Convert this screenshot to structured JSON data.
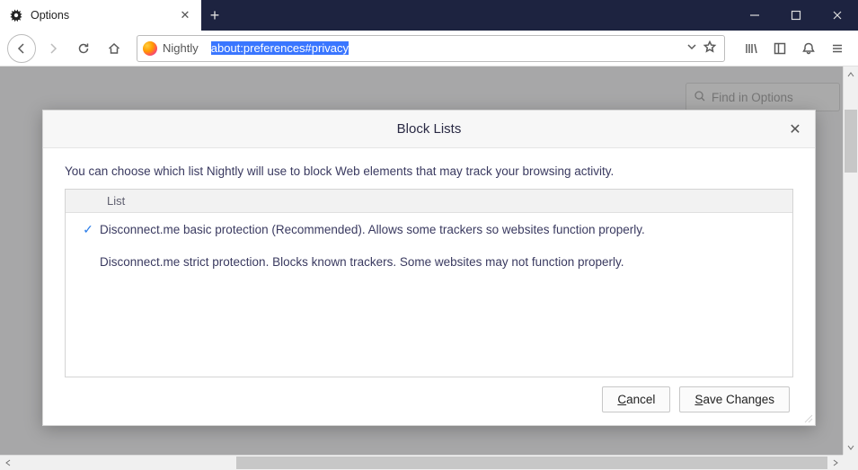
{
  "tab": {
    "title": "Options"
  },
  "url": {
    "identity_label": "Nightly",
    "value": "about:preferences#privacy"
  },
  "search": {
    "placeholder": "Find in Options"
  },
  "dialog": {
    "title": "Block Lists",
    "description": "You can choose which list Nightly will use to block Web elements that may track your browsing activity.",
    "column_label": "List",
    "items": [
      {
        "selected": true,
        "label": "Disconnect.me basic protection (Recommended). Allows some trackers so websites function properly."
      },
      {
        "selected": false,
        "label": "Disconnect.me strict protection. Blocks known trackers. Some websites may not function properly."
      }
    ],
    "cancel_label": "Cancel",
    "save_label": "Save Changes"
  }
}
